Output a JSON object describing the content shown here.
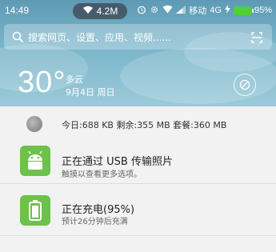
{
  "status_bar": {
    "time": "14:49",
    "speed": "4.2M",
    "carrier": "移动",
    "network": "4G",
    "battery_text": "95%",
    "battery_level": 0.95
  },
  "search": {
    "placeholder": "搜索网页、设置、应用、视频......"
  },
  "weather": {
    "temperature": "30°",
    "condition": "多云",
    "date": "9月4日 周日"
  },
  "data_usage": {
    "text": "今日:688 KB  剩余:355 MB  套餐:360 MB"
  },
  "notifications": [
    {
      "icon": "android-icon",
      "title": "正在通过 USB 传输照片",
      "subtitle": "触摸以查看更多选项。"
    },
    {
      "icon": "battery-icon",
      "title": "正在充电(95%)",
      "subtitle": "预计26分钟后充满"
    }
  ],
  "colors": {
    "header_top": "#5e9ab4",
    "header_bottom": "#9ccbd9",
    "app_green": "#6cc24a",
    "battery_green": "#4cd137",
    "panel_bg": "#f2f2f2"
  }
}
